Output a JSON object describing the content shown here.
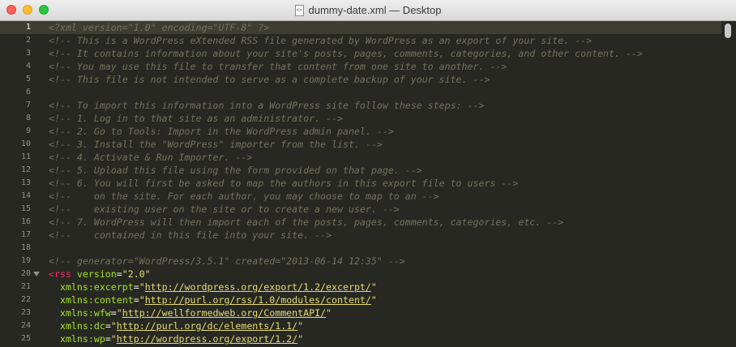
{
  "window": {
    "title": "dummy-date.xml — Desktop",
    "file_icon": "xml-file-icon",
    "file_icon_glyph": "<>"
  },
  "lines": [
    {
      "n": "1",
      "active": true,
      "parts": [
        [
          "c",
          "<?xml version=\"1.0\" encoding=\"UTF-8\" ?>"
        ]
      ]
    },
    {
      "n": "2",
      "parts": [
        [
          "c",
          "<!-- This is a WordPress eXtended RSS file generated by WordPress as an export of your site. -->"
        ]
      ]
    },
    {
      "n": "3",
      "parts": [
        [
          "c",
          "<!-- It contains information about your site's posts, pages, comments, categories, and other content. -->"
        ]
      ]
    },
    {
      "n": "4",
      "parts": [
        [
          "c",
          "<!-- You may use this file to transfer that content from one site to another. -->"
        ]
      ]
    },
    {
      "n": "5",
      "parts": [
        [
          "c",
          "<!-- This file is not intended to serve as a complete backup of your site. -->"
        ]
      ]
    },
    {
      "n": "6",
      "parts": []
    },
    {
      "n": "7",
      "parts": [
        [
          "c",
          "<!-- To import this information into a WordPress site follow these steps: -->"
        ]
      ]
    },
    {
      "n": "8",
      "parts": [
        [
          "c",
          "<!-- 1. Log in to that site as an administrator. -->"
        ]
      ]
    },
    {
      "n": "9",
      "parts": [
        [
          "c",
          "<!-- 2. Go to Tools: Import in the WordPress admin panel. -->"
        ]
      ]
    },
    {
      "n": "10",
      "parts": [
        [
          "c",
          "<!-- 3. Install the \"WordPress\" importer from the list. -->"
        ]
      ]
    },
    {
      "n": "11",
      "parts": [
        [
          "c",
          "<!-- 4. Activate & Run Importer. -->"
        ]
      ]
    },
    {
      "n": "12",
      "parts": [
        [
          "c",
          "<!-- 5. Upload this file using the form provided on that page. -->"
        ]
      ]
    },
    {
      "n": "13",
      "parts": [
        [
          "c",
          "<!-- 6. You will first be asked to map the authors in this export file to users -->"
        ]
      ]
    },
    {
      "n": "14",
      "parts": [
        [
          "c",
          "<!--    on the site. For each author, you may choose to map to an -->"
        ]
      ]
    },
    {
      "n": "15",
      "parts": [
        [
          "c",
          "<!--    existing user on the site or to create a new user. -->"
        ]
      ]
    },
    {
      "n": "16",
      "parts": [
        [
          "c",
          "<!-- 7. WordPress will then import each of the posts, pages, comments, categories, etc. -->"
        ]
      ]
    },
    {
      "n": "17",
      "parts": [
        [
          "c",
          "<!--    contained in this file into your site. -->"
        ]
      ]
    },
    {
      "n": "18",
      "parts": []
    },
    {
      "n": "19",
      "parts": [
        [
          "c",
          "<!-- generator=\"WordPress/3.5.1\" created=\"2013-06-14 12:35\" -->"
        ]
      ]
    },
    {
      "n": "20",
      "fold": true,
      "parts": [
        [
          "t",
          "<rss "
        ],
        [
          "a",
          "version"
        ],
        [
          "p",
          "="
        ],
        [
          "s",
          "\"2.0\""
        ]
      ]
    },
    {
      "n": "21",
      "parts": [
        [
          "p",
          "  "
        ],
        [
          "a",
          "xmlns:excerpt"
        ],
        [
          "p",
          "="
        ],
        [
          "s",
          "\""
        ],
        [
          "u",
          "http://wordpress.org/export/1.2/excerpt/"
        ],
        [
          "s",
          "\""
        ]
      ]
    },
    {
      "n": "22",
      "parts": [
        [
          "p",
          "  "
        ],
        [
          "a",
          "xmlns:content"
        ],
        [
          "p",
          "="
        ],
        [
          "s",
          "\""
        ],
        [
          "u",
          "http://purl.org/rss/1.0/modules/content/"
        ],
        [
          "s",
          "\""
        ]
      ]
    },
    {
      "n": "23",
      "parts": [
        [
          "p",
          "  "
        ],
        [
          "a",
          "xmlns:wfw"
        ],
        [
          "p",
          "="
        ],
        [
          "s",
          "\""
        ],
        [
          "u",
          "http://wellformedweb.org/CommentAPI/"
        ],
        [
          "s",
          "\""
        ]
      ]
    },
    {
      "n": "24",
      "parts": [
        [
          "p",
          "  "
        ],
        [
          "a",
          "xmlns:dc"
        ],
        [
          "p",
          "="
        ],
        [
          "s",
          "\""
        ],
        [
          "u",
          "http://purl.org/dc/elements/1.1/"
        ],
        [
          "s",
          "\""
        ]
      ]
    },
    {
      "n": "25",
      "parts": [
        [
          "p",
          "  "
        ],
        [
          "a",
          "xmlns:wp"
        ],
        [
          "p",
          "="
        ],
        [
          "s",
          "\""
        ],
        [
          "u",
          "http://wordpress.org/export/1.2/"
        ],
        [
          "s",
          "\""
        ]
      ]
    }
  ],
  "colors": {
    "background": "#272822",
    "comment": "#75715e",
    "tag": "#f92672",
    "attribute": "#a6e22e",
    "string": "#e6db74",
    "text": "#f8f8f2"
  }
}
